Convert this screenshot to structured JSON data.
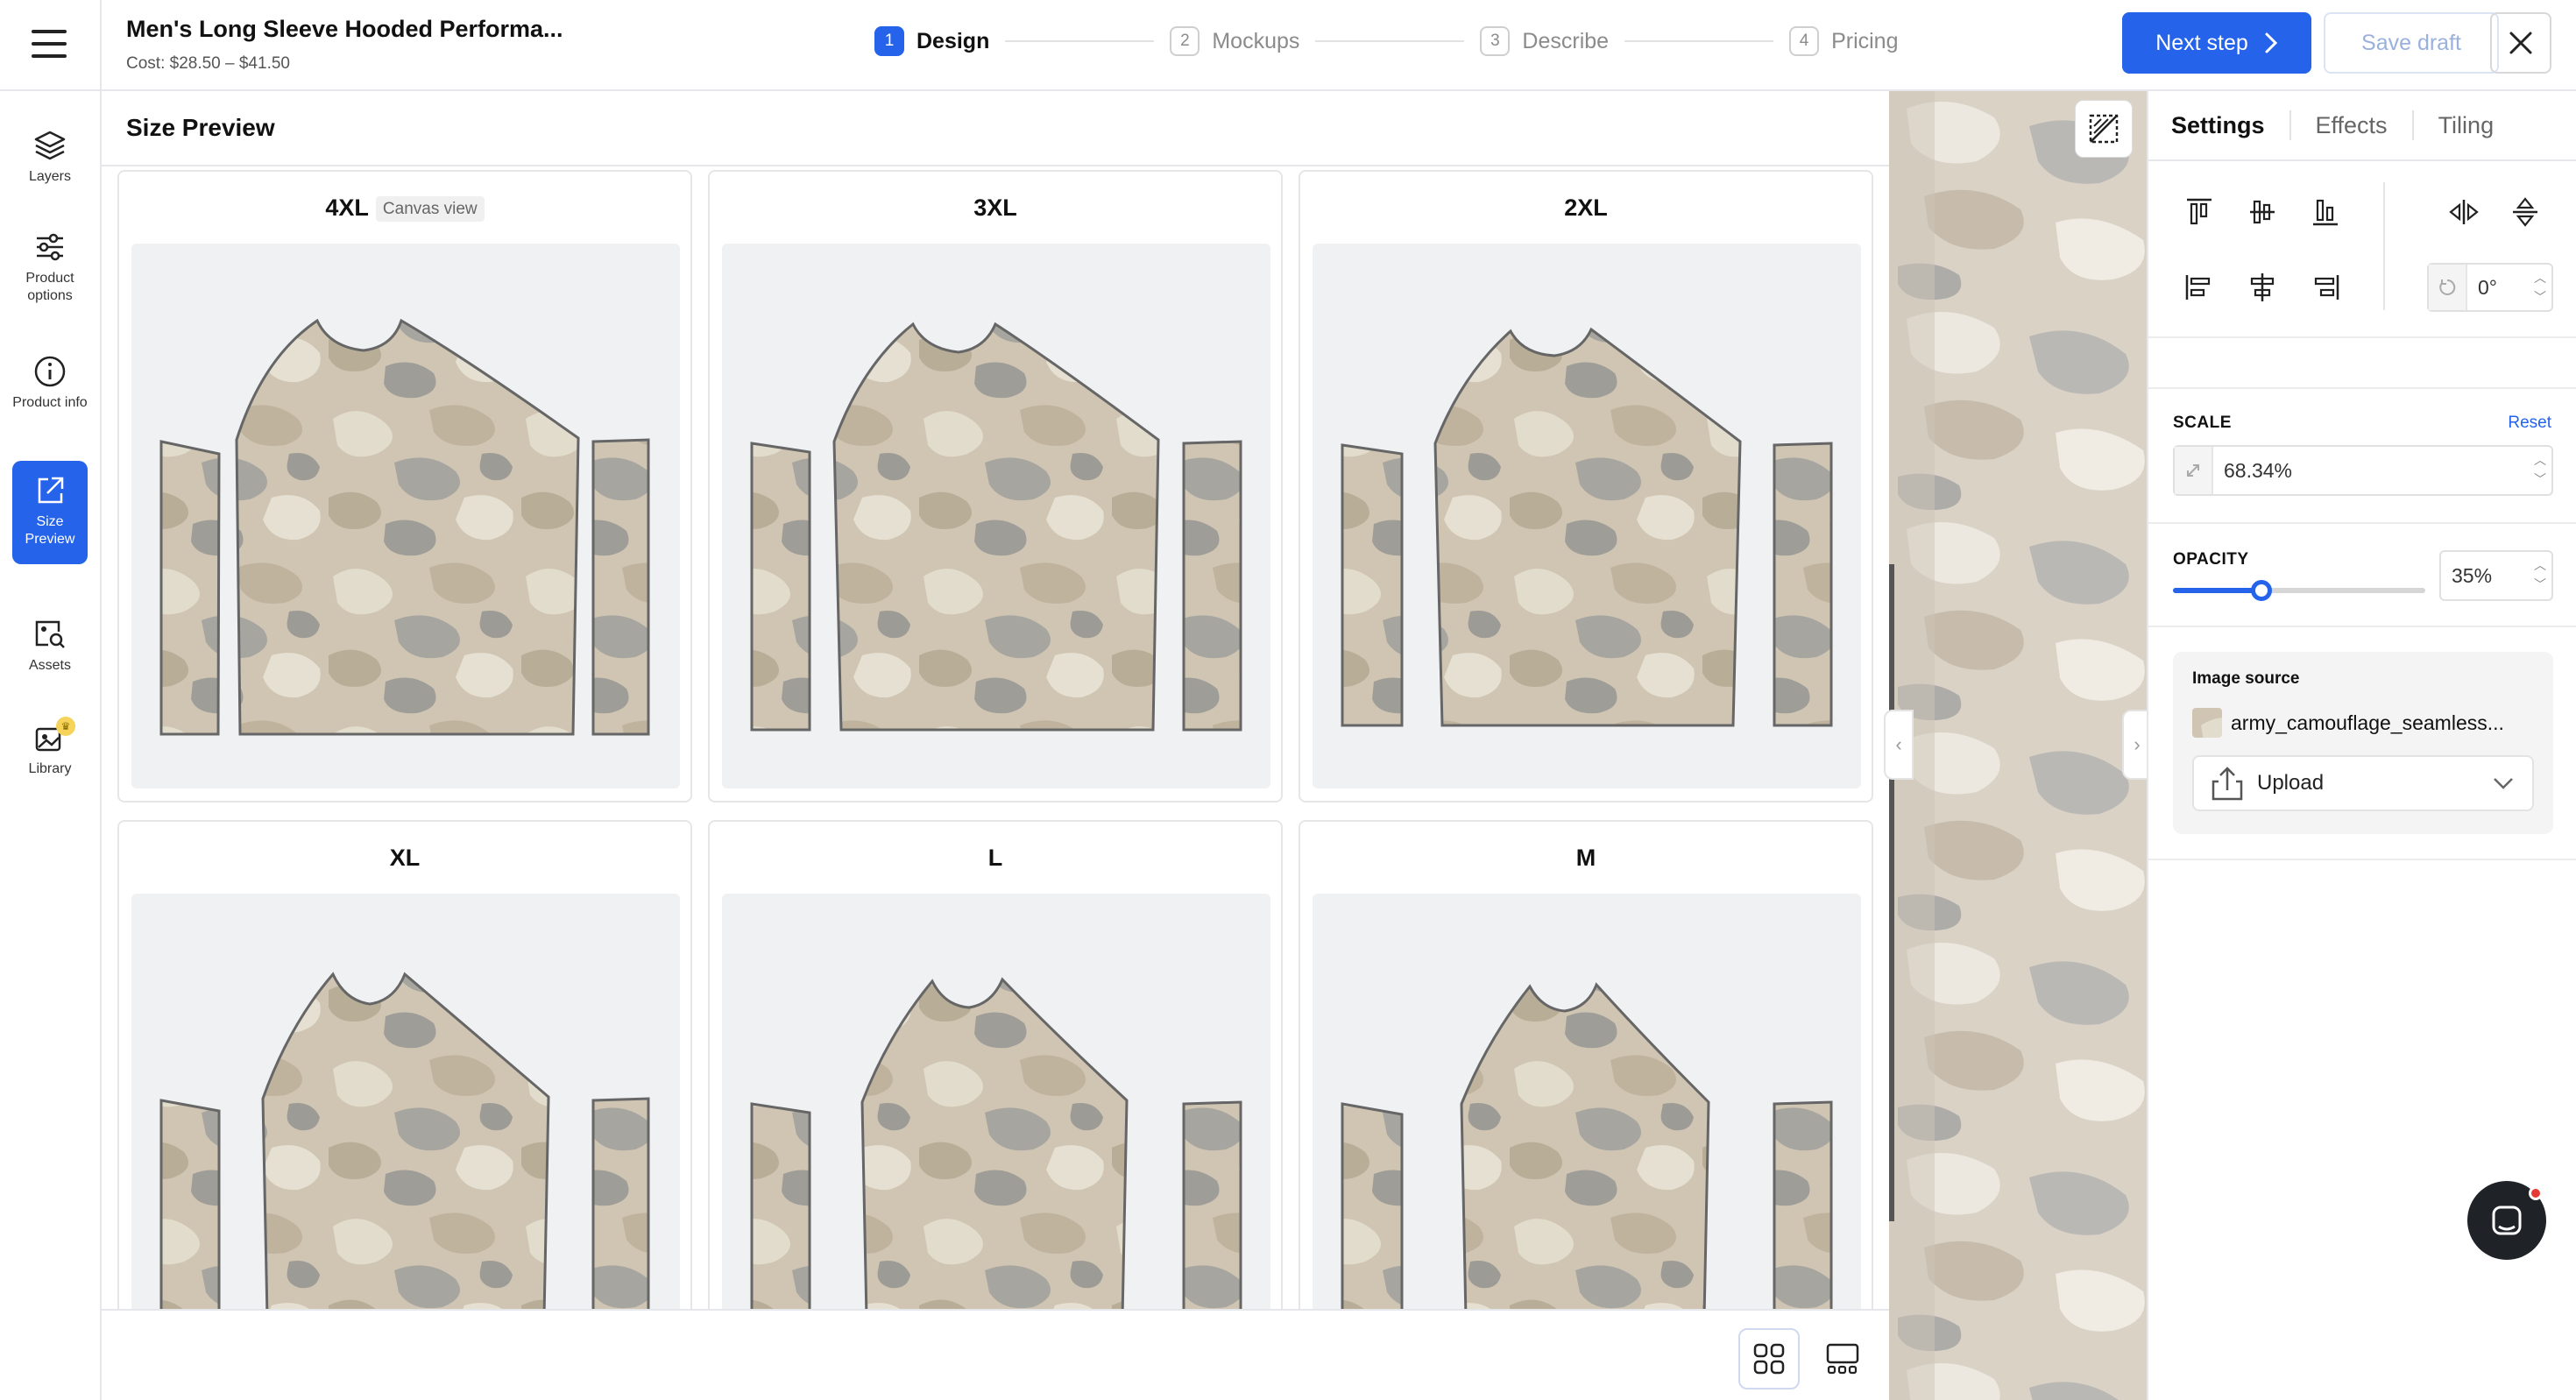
{
  "header": {
    "product_title": "Men's Long Sleeve Hooded Performa...",
    "cost": "Cost: $28.50 – $41.50",
    "steps": [
      {
        "num": "1",
        "label": "Design"
      },
      {
        "num": "2",
        "label": "Mockups"
      },
      {
        "num": "3",
        "label": "Describe"
      },
      {
        "num": "4",
        "label": "Pricing"
      }
    ],
    "next_label": "Next step",
    "save_label": "Save draft"
  },
  "nav": [
    {
      "label": "Layers",
      "icon": "layers-icon"
    },
    {
      "label": "Product options",
      "icon": "sliders-icon"
    },
    {
      "label": "Product info",
      "icon": "info-icon"
    },
    {
      "label": "Size Preview",
      "icon": "external-link-icon"
    },
    {
      "label": "Assets",
      "icon": "image-search-icon"
    },
    {
      "label": "Library",
      "icon": "library-icon"
    }
  ],
  "main": {
    "title": "Size Preview",
    "canvas_tag": "Canvas view",
    "sizes": [
      "4XL",
      "3XL",
      "2XL",
      "XL",
      "L",
      "M"
    ]
  },
  "panel": {
    "tabs": [
      "Settings",
      "Effects",
      "Tiling"
    ],
    "rotation": "0°",
    "scale_label": "SCALE",
    "reset_label": "Reset",
    "scale_value": "68.34%",
    "opacity_label": "OPACITY",
    "opacity_value": "35%",
    "opacity_level": 0.35,
    "image_source_label": "Image source",
    "image_source_file": "army_camouflage_seamless...",
    "upload_label": "Upload"
  },
  "colors": {
    "accent": "#2563eb",
    "camo_base": "#d8cfbd"
  }
}
